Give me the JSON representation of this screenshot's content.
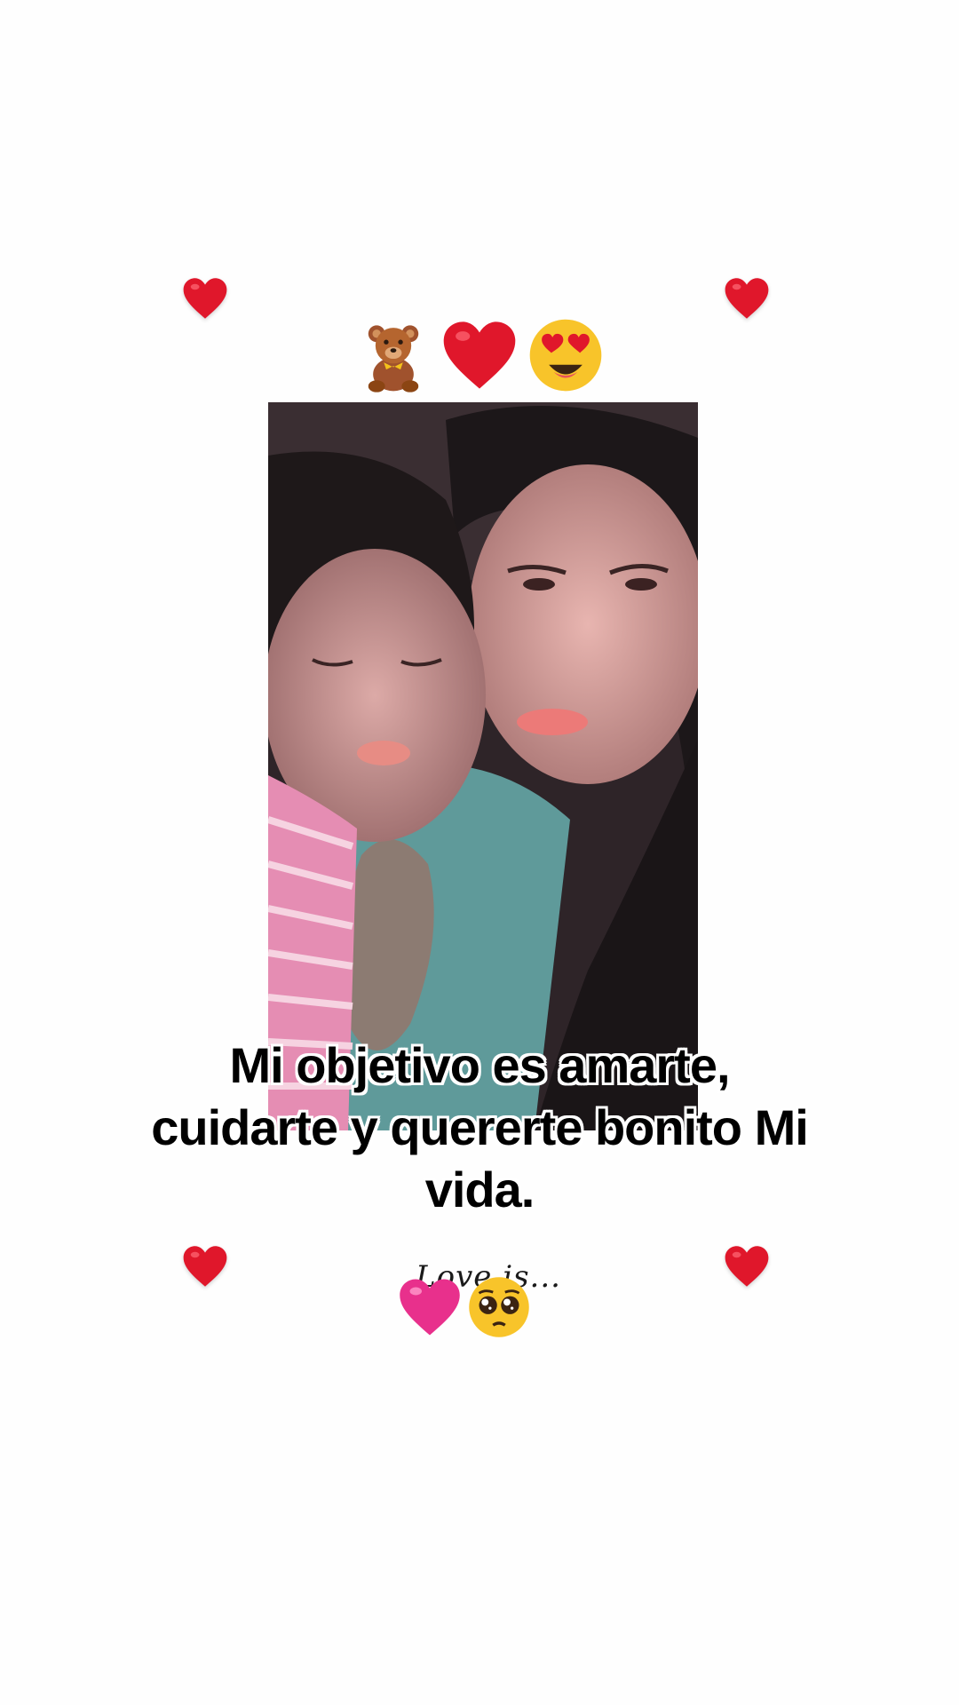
{
  "icons": {
    "corner_heart": "red-heart-icon",
    "top_row": [
      "teddy-bear-icon",
      "red-heart-icon",
      "heart-eyes-face-icon"
    ],
    "bottom_row": [
      "pink-heart-icon",
      "pleading-face-icon"
    ]
  },
  "caption": {
    "line1": "Mi objetivo es amarte,",
    "line2": "cuidarte y quererte bonito Mi",
    "line3": "vida."
  },
  "script_text": "Love is...",
  "colors": {
    "heart_red": "#e0172b",
    "pink_heart": "#e8308c",
    "emoji_yellow": "#f8c42a",
    "background": "#ffffff"
  }
}
